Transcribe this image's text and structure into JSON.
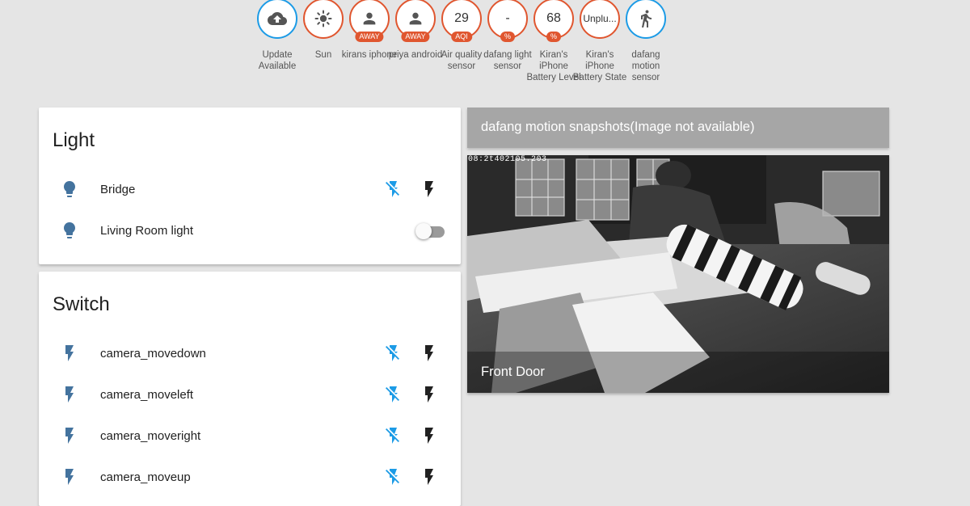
{
  "badges": [
    {
      "value": "",
      "label": "Update Available",
      "icon": "cloud-upload-icon",
      "tag": "",
      "color": "blue"
    },
    {
      "value": "",
      "label": "Sun",
      "icon": "sun-icon",
      "tag": "",
      "color": "orange"
    },
    {
      "value": "",
      "label": "kirans iphone",
      "icon": "person-icon",
      "tag": "AWAY",
      "color": "orange"
    },
    {
      "value": "",
      "label": "priya android",
      "icon": "person-icon",
      "tag": "AWAY",
      "color": "orange"
    },
    {
      "value": "29",
      "label": "Air quality sensor",
      "icon": "",
      "tag": "AQI",
      "color": "orange"
    },
    {
      "value": "-",
      "label": "dafang light sensor",
      "icon": "",
      "tag": "%",
      "color": "orange"
    },
    {
      "value": "68",
      "label": "Kiran's iPhone Battery Level",
      "icon": "",
      "tag": "%",
      "color": "orange"
    },
    {
      "value": "Unplu...",
      "label": "Kiran's iPhone Battery State",
      "icon": "",
      "tag": "",
      "color": "orange"
    },
    {
      "value": "",
      "label": "dafang motion sensor",
      "icon": "walk-icon",
      "tag": "",
      "color": "blue"
    }
  ],
  "light_card": {
    "title": "Light",
    "items": [
      {
        "name": "Bridge",
        "icon": "lightbulb-icon",
        "control": "flash-buttons"
      },
      {
        "name": "Living Room light",
        "icon": "lightbulb-icon",
        "control": "toggle",
        "state": "off"
      }
    ]
  },
  "switch_card": {
    "title": "Switch",
    "items": [
      {
        "name": "camera_movedown",
        "icon": "flash-icon"
      },
      {
        "name": "camera_moveleft",
        "icon": "flash-icon"
      },
      {
        "name": "camera_moveright",
        "icon": "flash-icon"
      },
      {
        "name": "camera_moveup",
        "icon": "flash-icon"
      }
    ]
  },
  "camera": {
    "header": "dafang motion snapshots(Image not available)",
    "timestamp": "08:2t402105.203",
    "name": "Front Door"
  },
  "colors": {
    "accent_orange": "#e0562f",
    "accent_blue": "#1c9be6",
    "icon_blue": "#44739e",
    "background": "#e5e5e5"
  }
}
